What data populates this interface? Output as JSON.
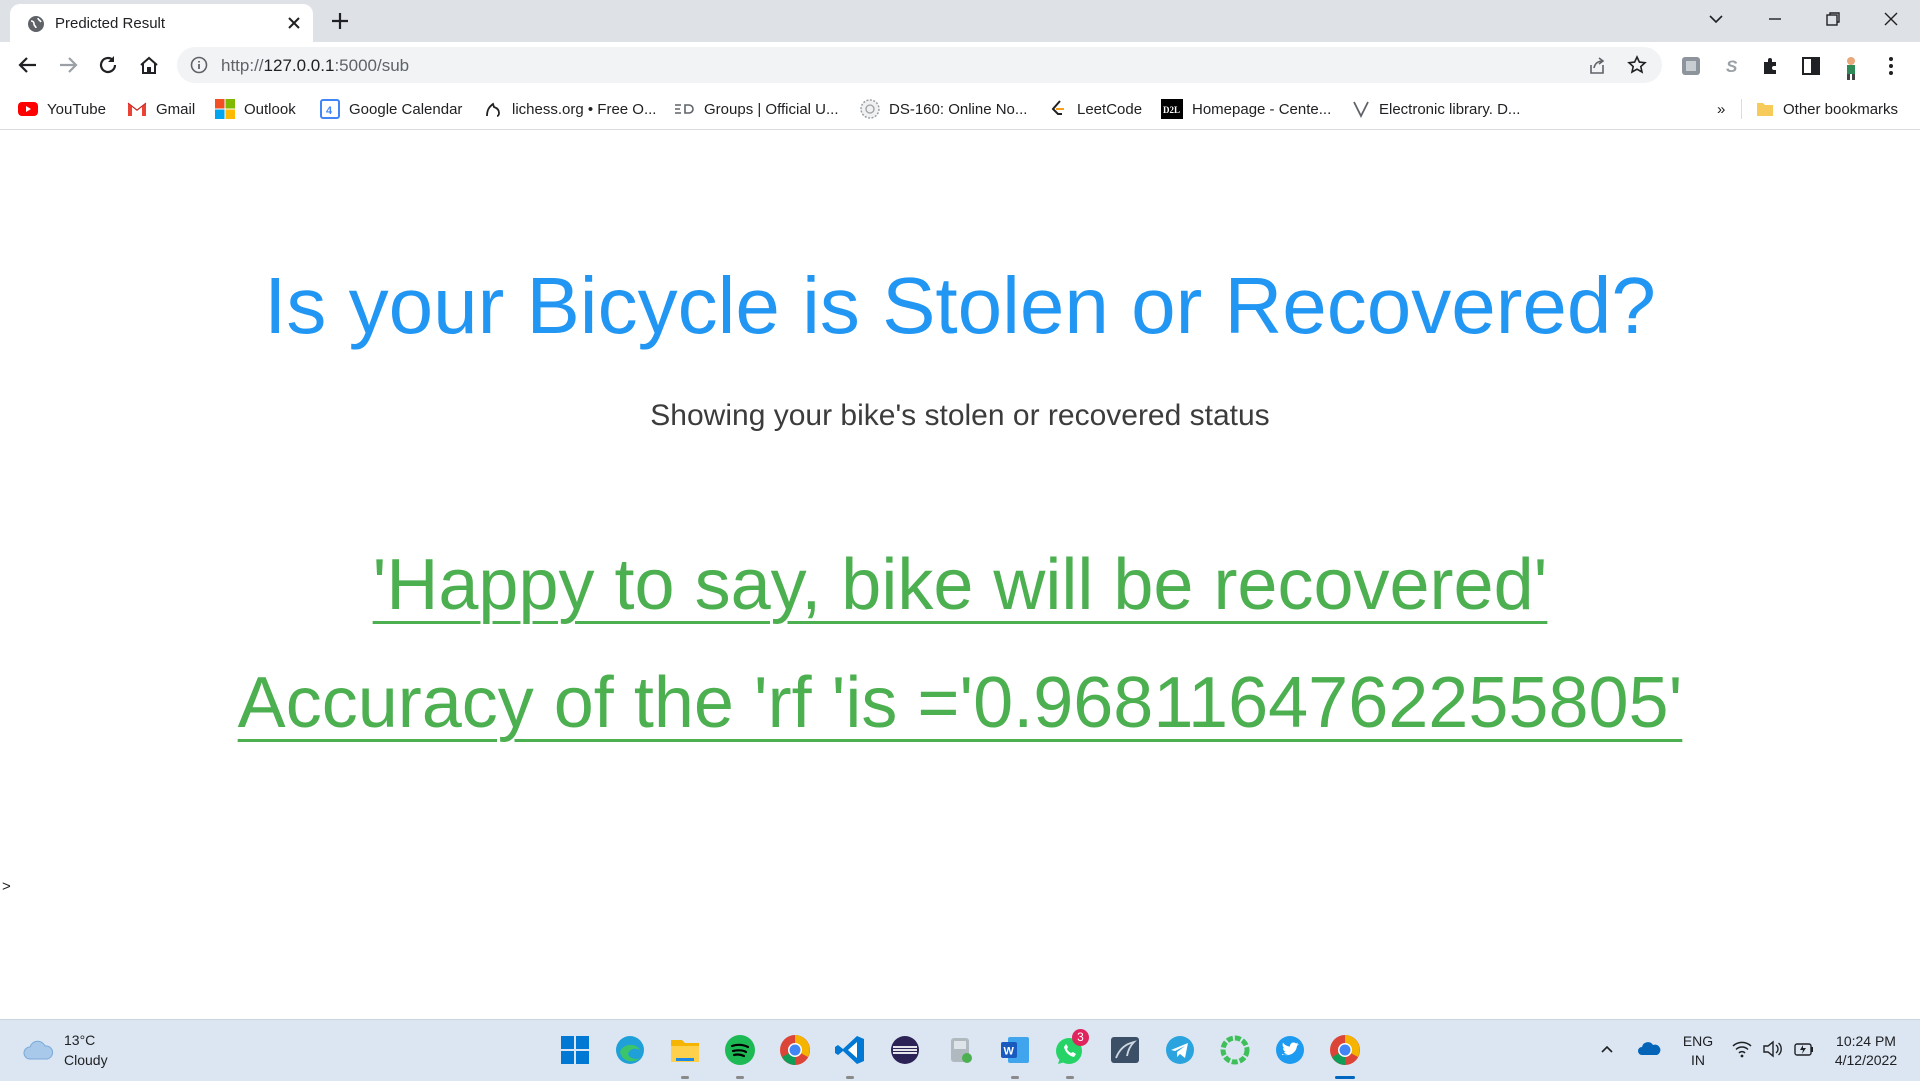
{
  "tab": {
    "title": "Predicted Result"
  },
  "address": {
    "scheme": "http://",
    "host": "127.0.0.1",
    "path": ":5000/sub"
  },
  "bookmarks": [
    {
      "label": "YouTube",
      "icon": "youtube-icon"
    },
    {
      "label": "Gmail",
      "icon": "gmail-icon"
    },
    {
      "label": "Outlook",
      "icon": "microsoft-icon"
    },
    {
      "label": "Google Calendar",
      "icon": "calendar-icon"
    },
    {
      "label": "lichess.org • Free O...",
      "icon": "lichess-icon"
    },
    {
      "label": "Groups | Official U...",
      "icon": "groups-icon"
    },
    {
      "label": "DS-160: Online No...",
      "icon": "seal-icon"
    },
    {
      "label": "LeetCode",
      "icon": "leetcode-icon"
    },
    {
      "label": "Homepage - Cente...",
      "icon": "d2l-icon"
    },
    {
      "label": "Electronic library. D...",
      "icon": "library-icon"
    }
  ],
  "bookmarks_overflow": "»",
  "other_bookmarks": "Other bookmarks",
  "page": {
    "heading": "Is your Bicycle is Stolen or Recovered?",
    "subheading": "Showing your bike's stolen or recovered status",
    "result": "'Happy to say, bike will be recovered'",
    "accuracy": "Accuracy of the 'rf 'is ='0.9681164762255805'",
    "stray": ">"
  },
  "taskbar": {
    "weather": {
      "temp": "13°C",
      "condition": "Cloudy"
    },
    "apps": [
      "start",
      "edge",
      "file-explorer",
      "spotify",
      "chrome",
      "vscode",
      "eclipse",
      "disk-app",
      "word",
      "whatsapp",
      "sql-app",
      "telegram",
      "circle-app",
      "twitter",
      "chrome-active"
    ],
    "whatsapp_badge": "3",
    "language": {
      "lang": "ENG",
      "region": "IN"
    },
    "clock": {
      "time": "10:24 PM",
      "date": "4/12/2022"
    }
  },
  "colors": {
    "heading": "#2196f3",
    "result": "#4caf50",
    "chrome_frame": "#dee1e6",
    "taskbar": "#dbe6f2"
  }
}
